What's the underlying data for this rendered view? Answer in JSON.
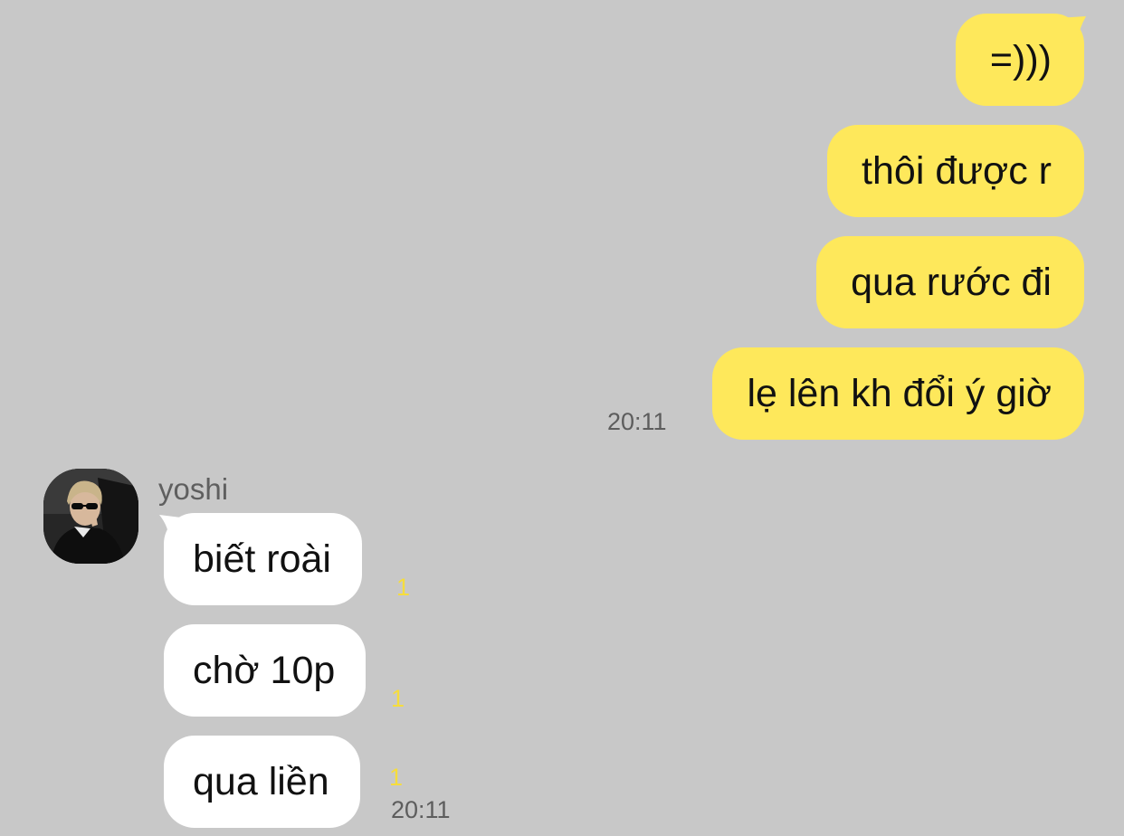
{
  "chat": {
    "outgoing": [
      {
        "text": "=)))"
      },
      {
        "text": "thôi được r"
      },
      {
        "text": "qua rước đi"
      },
      {
        "text": "lẹ lên kh đổi ý giờ",
        "time": "20:11"
      }
    ],
    "incoming": {
      "sender_name": "yoshi",
      "avatar_icon": "profile-photo",
      "messages": [
        {
          "text": "biết roài",
          "unread": "1"
        },
        {
          "text": "chờ 10p",
          "unread": "1"
        },
        {
          "text": "qua liền",
          "unread": "1",
          "time": "20:11"
        }
      ]
    }
  },
  "colors": {
    "background": "#c8c8c8",
    "outgoing_bubble": "#fee85b",
    "incoming_bubble": "#ffffff",
    "unread_count": "#f6dd3c",
    "timestamp": "#5d5d5d"
  }
}
